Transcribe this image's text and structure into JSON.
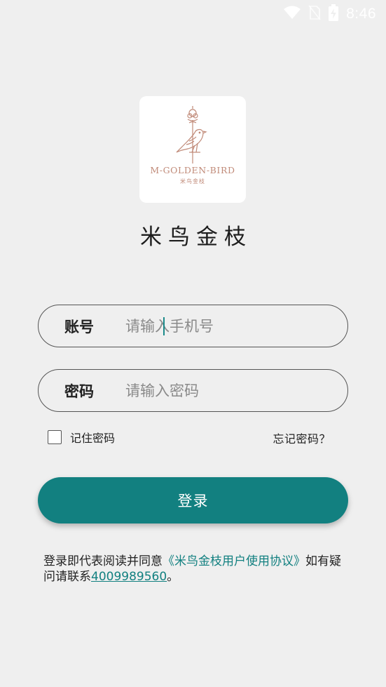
{
  "status_bar": {
    "time": "8:46",
    "icons": [
      "wifi-icon",
      "no-sim-icon",
      "battery-charging-icon"
    ]
  },
  "logo": {
    "brand_text": "M-GOLDEN-BIRD",
    "sub_text": "米鸟金枝"
  },
  "app_name": "米鸟金枝",
  "account_field": {
    "label": "账号",
    "placeholder": "请输入手机号",
    "value": ""
  },
  "password_field": {
    "label": "密码",
    "placeholder": "请输入密码",
    "value": ""
  },
  "remember": {
    "label": "记住密码",
    "checked": false
  },
  "forgot_password": "忘记密码？",
  "login_button": "登录",
  "agreement": {
    "prefix": "登录即代表阅读并同意",
    "link": "《米鸟金枝用户使用协议》",
    "middle": "如有疑问请联系",
    "phone": "4009989560",
    "suffix": "。"
  },
  "colors": {
    "accent": "#128080",
    "logo": "#c08a78",
    "background": "#efefef"
  }
}
